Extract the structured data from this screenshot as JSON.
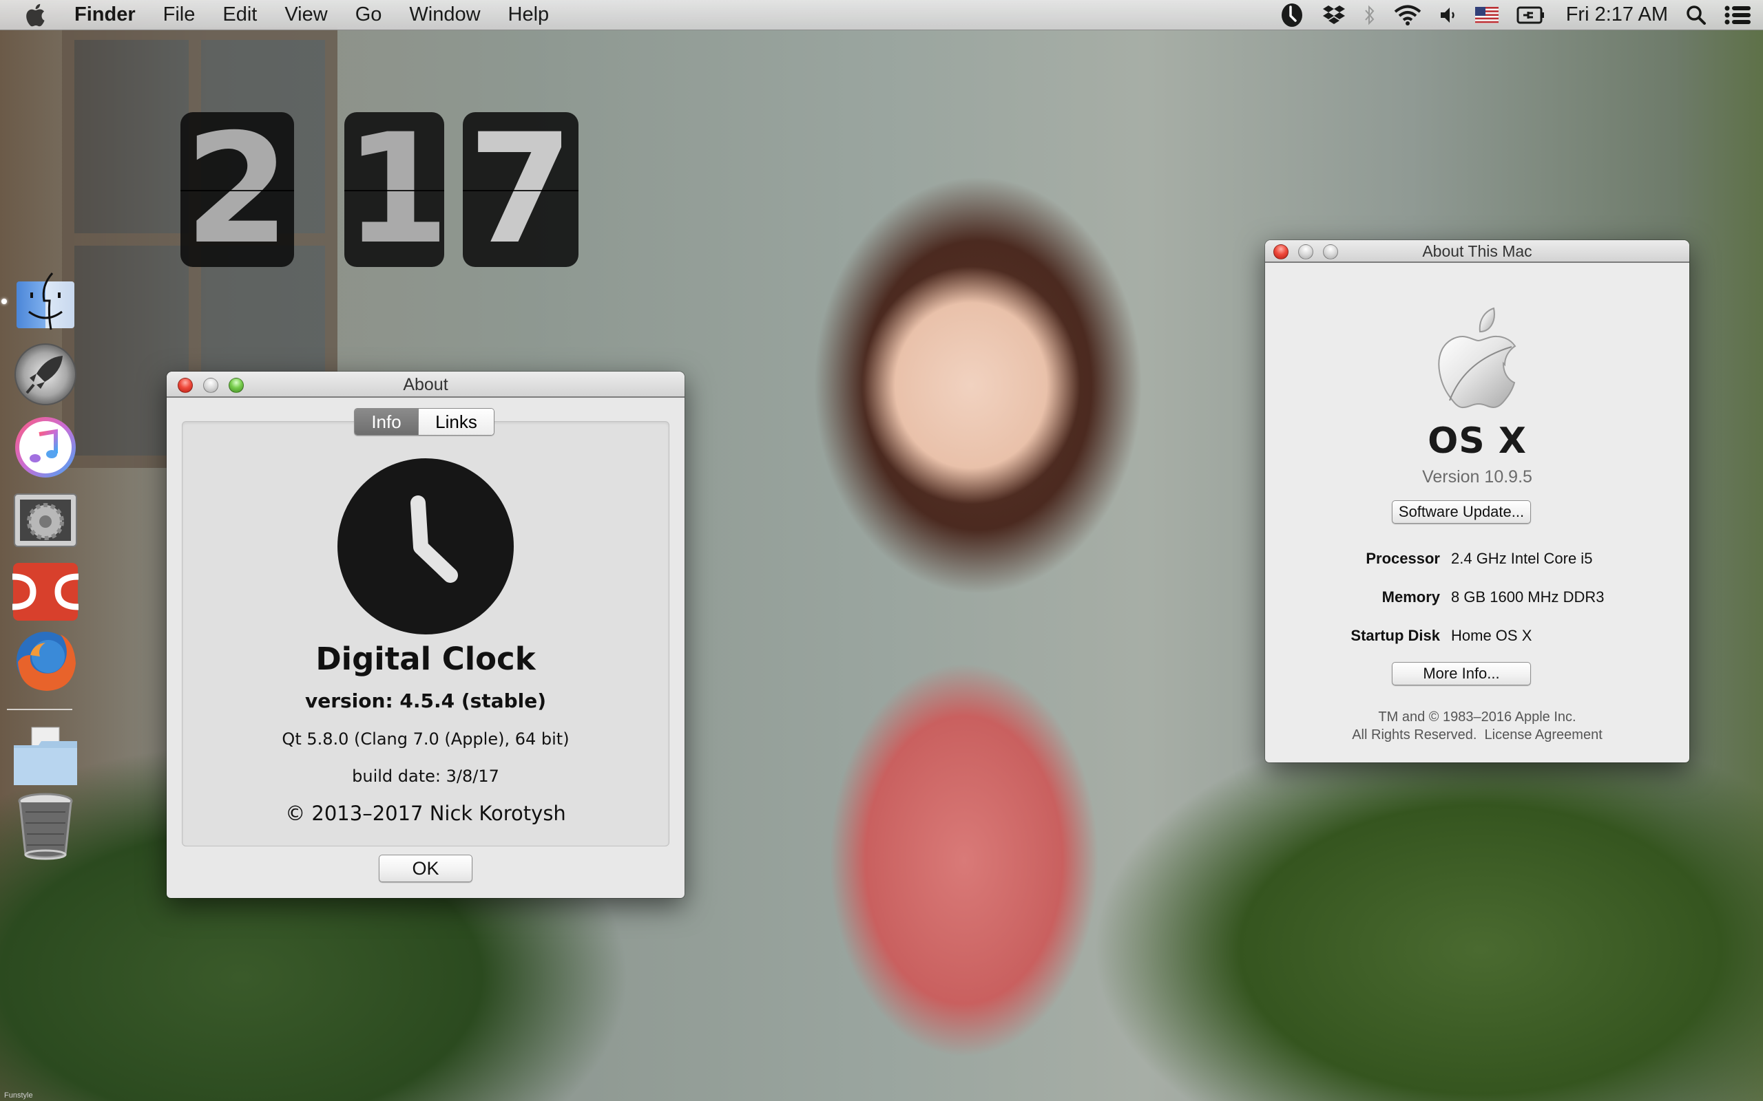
{
  "menubar": {
    "apple_icon": "apple-logo-icon",
    "app_name": "Finder",
    "menus": [
      "File",
      "Edit",
      "View",
      "Go",
      "Window",
      "Help"
    ],
    "status_icons": [
      "digital-clock-icon",
      "dropbox-icon",
      "bluetooth-icon",
      "wifi-icon",
      "volume-icon",
      "us-flag-input-icon",
      "battery-charging-icon"
    ],
    "clock": "Fri 2:17 AM",
    "spotlight_icon": "search-icon",
    "notification_icon": "list-icon"
  },
  "desktop_clock": {
    "hour": "2",
    "minute_tens": "1",
    "minute_ones": "7"
  },
  "dock": {
    "items": [
      {
        "name": "Finder",
        "icon": "finder-icon",
        "running": true
      },
      {
        "name": "Launchpad",
        "icon": "rocket-icon",
        "running": false
      },
      {
        "name": "iTunes",
        "icon": "music-note-icon",
        "running": false
      },
      {
        "name": "System Preferences",
        "icon": "gear-icon",
        "running": false
      },
      {
        "name": "Doxie",
        "icon": "doxie-icon",
        "running": false
      },
      {
        "name": "Firefox",
        "icon": "firefox-icon",
        "running": false
      },
      {
        "name": "Documents",
        "icon": "folder-icon",
        "running": false
      },
      {
        "name": "Trash",
        "icon": "trash-icon",
        "running": false
      }
    ]
  },
  "about_dialog": {
    "title": "About",
    "tabs": [
      {
        "label": "Info",
        "active": true
      },
      {
        "label": "Links",
        "active": false
      }
    ],
    "app_title": "Digital Clock",
    "version": "version: 4.5.4 (stable)",
    "qt_info": "Qt 5.8.0 (Clang 7.0 (Apple), 64 bit)",
    "build_date": "build date: 3/8/17",
    "copyright": "© 2013–2017 Nick Korotysh",
    "ok_label": "OK"
  },
  "about_this_mac": {
    "title": "About This Mac",
    "os_name": "OS X",
    "version": "Version 10.9.5",
    "software_update_label": "Software Update...",
    "specs": [
      {
        "label": "Processor",
        "value": "2.4 GHz Intel Core i5"
      },
      {
        "label": "Memory",
        "value": "8 GB 1600 MHz DDR3"
      },
      {
        "label": "Startup Disk",
        "value": "Home OS X"
      }
    ],
    "more_info_label": "More Info...",
    "legal_line1": "TM and © 1983–2016 Apple Inc.",
    "legal_line2": "All Rights Reserved.",
    "license_link": "License Agreement"
  },
  "watermark": "Funstyle",
  "colors": {
    "close_red": "#ef4a3c",
    "zoom_green": "#77cc4c",
    "tab_active": "#7a7a7a",
    "window_bg": "#e8e8e8"
  }
}
